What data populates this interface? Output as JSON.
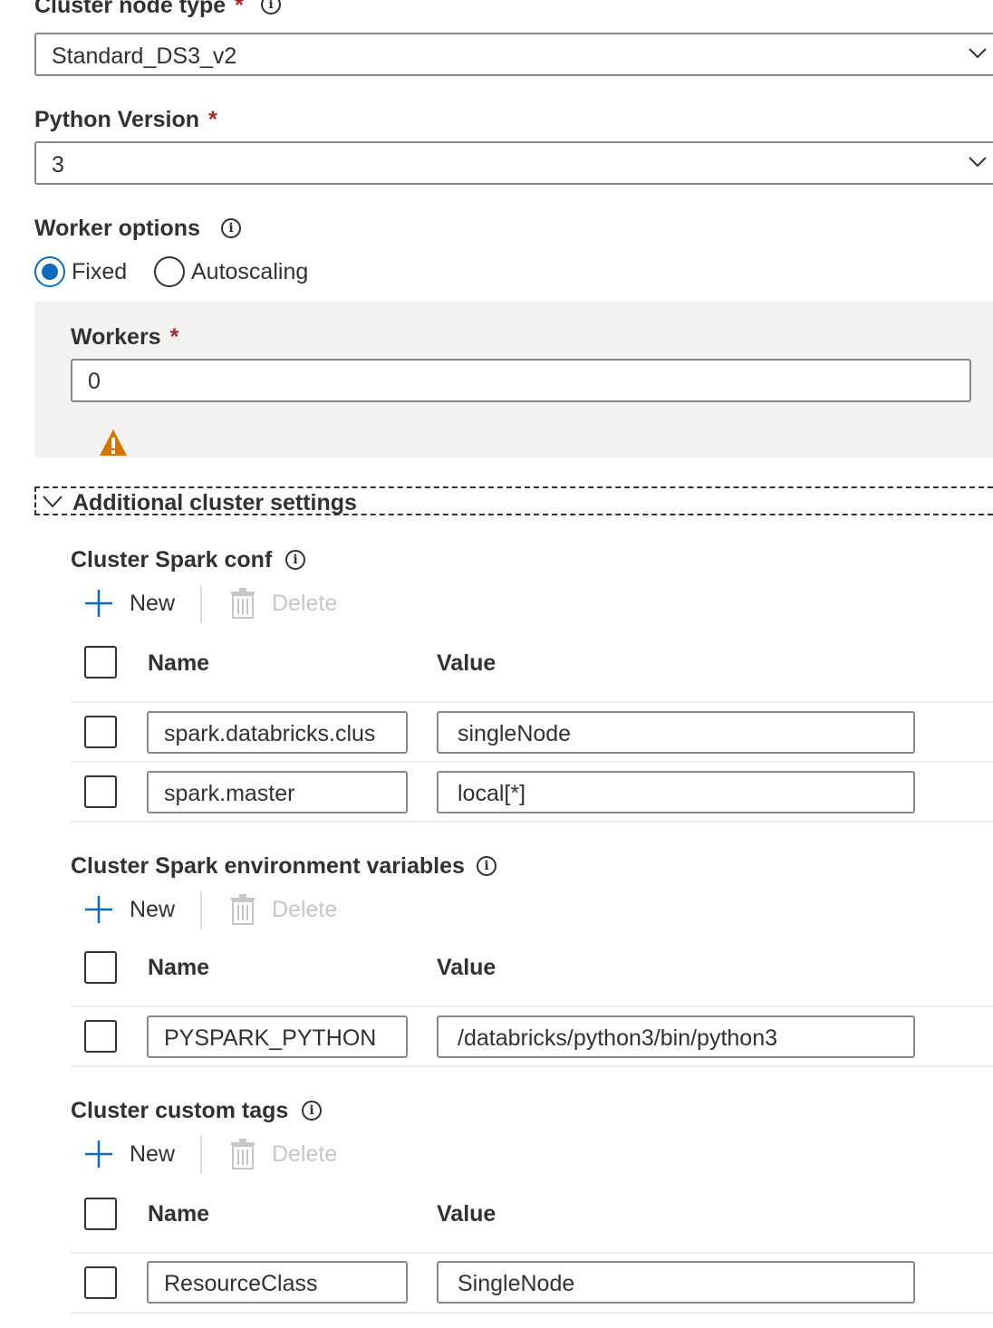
{
  "cluster_node_type": {
    "label": "Cluster node type",
    "required_mark": "*",
    "value": "Standard_DS3_v2"
  },
  "python_version": {
    "label": "Python Version",
    "required_mark": "*",
    "value": "3"
  },
  "worker_options": {
    "label": "Worker options",
    "options": [
      {
        "label": "Fixed",
        "selected": true
      },
      {
        "label": "Autoscaling",
        "selected": false
      }
    ]
  },
  "workers": {
    "label": "Workers",
    "required_mark": "*",
    "value": "0"
  },
  "additional_settings": {
    "title": "Additional cluster settings",
    "expanded": true
  },
  "spark_conf": {
    "title": "Cluster Spark conf",
    "new_label": "New",
    "delete_label": "Delete",
    "columns": [
      "Name",
      "Value"
    ],
    "rows": [
      {
        "name": "spark.databricks.clus",
        "value": "singleNode"
      },
      {
        "name": "spark.master",
        "value": "local[*]"
      }
    ]
  },
  "spark_env": {
    "title": "Cluster Spark environment variables",
    "new_label": "New",
    "delete_label": "Delete",
    "columns": [
      "Name",
      "Value"
    ],
    "rows": [
      {
        "name": "PYSPARK_PYTHON",
        "value": "/databricks/python3/bin/python3"
      }
    ]
  },
  "custom_tags": {
    "title": "Cluster custom tags",
    "new_label": "New",
    "delete_label": "Delete",
    "columns": [
      "Name",
      "Value"
    ],
    "rows": [
      {
        "name": "ResourceClass",
        "value": "SingleNode"
      }
    ]
  },
  "colors": {
    "accent": "#0f6cbd",
    "required": "#a4262c",
    "warning": "#d47500",
    "disabled": "#c8c6c4",
    "panel_bg": "#f3f2f1"
  },
  "icons": [
    "info-icon",
    "chevron-down-icon",
    "warning-icon",
    "plus-icon",
    "trash-icon"
  ]
}
